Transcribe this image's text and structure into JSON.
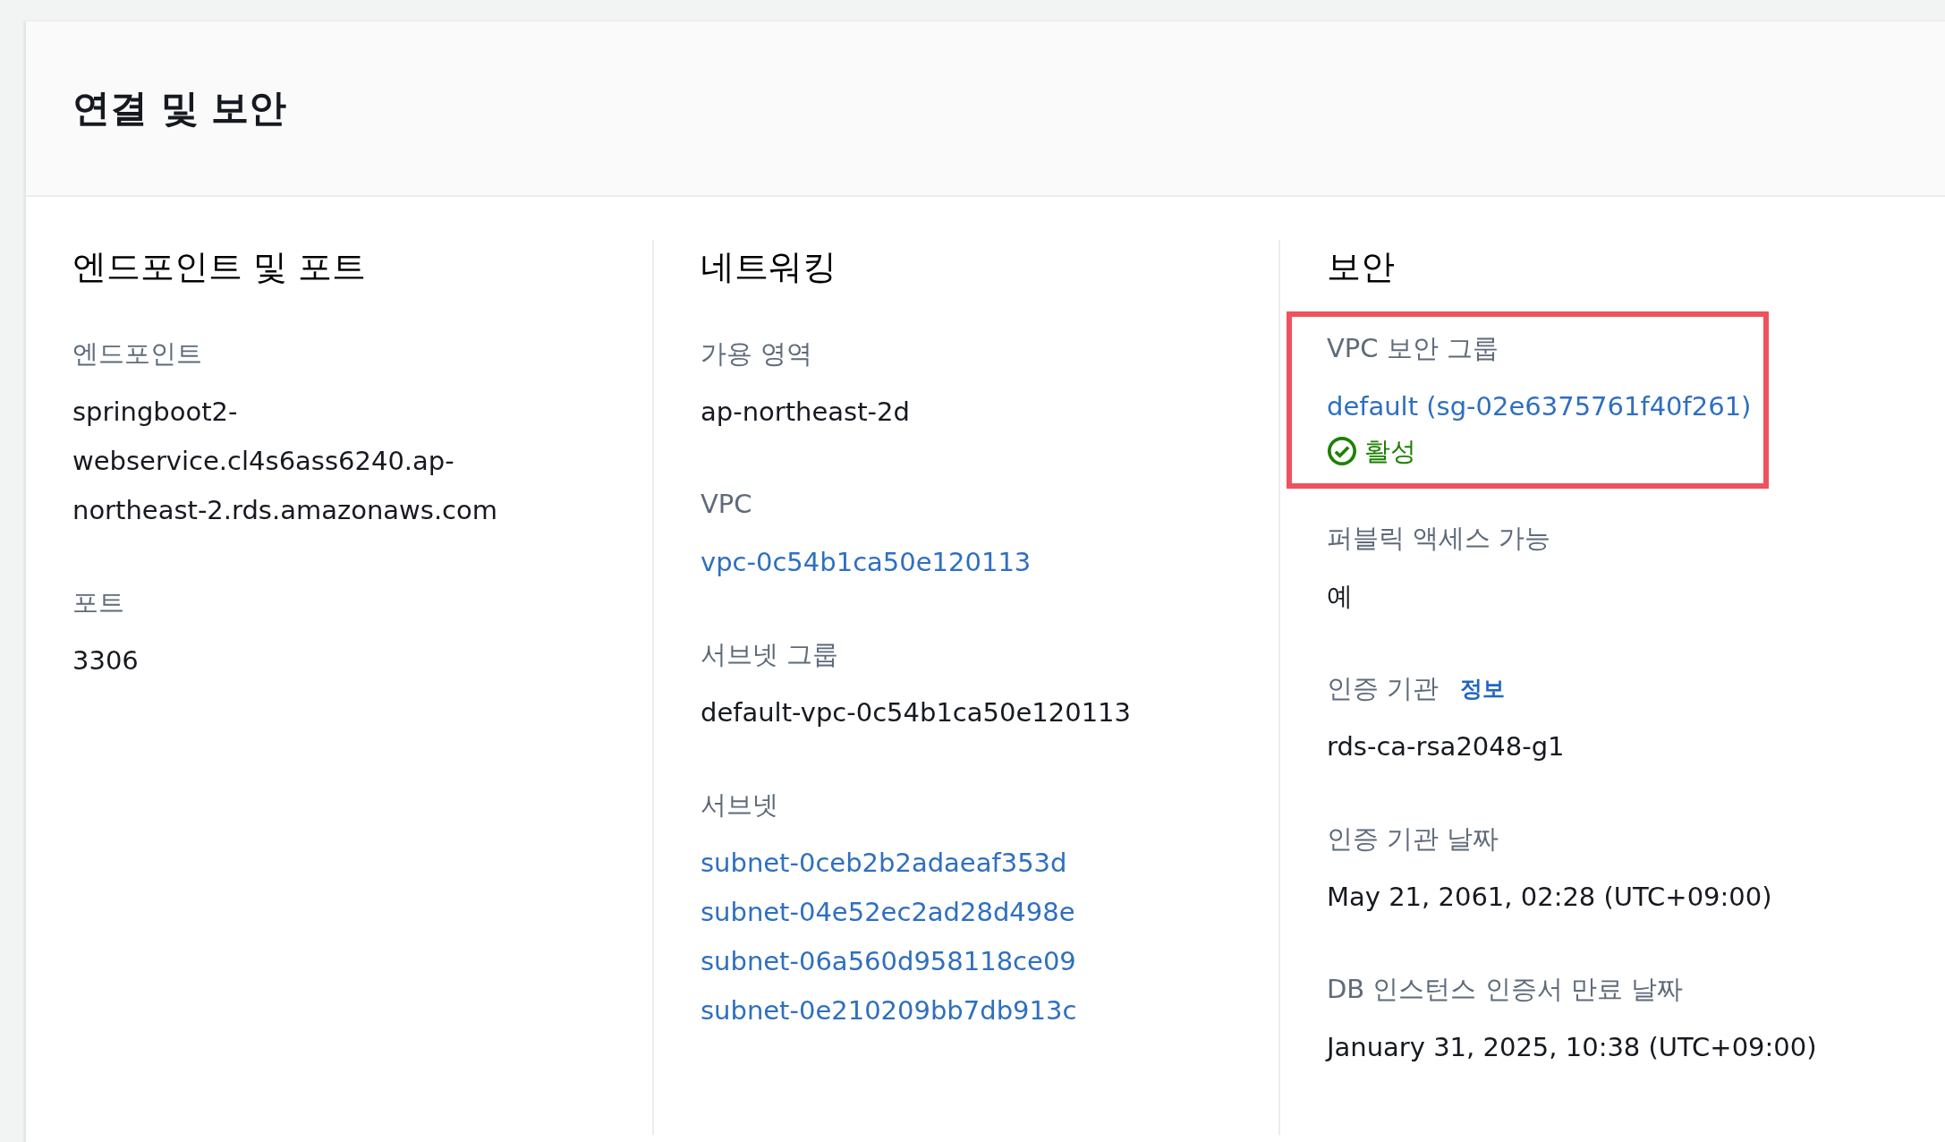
{
  "panel": {
    "title": "연결 및 보안"
  },
  "columns": [
    {
      "heading": "엔드포인트 및 포트",
      "fields": [
        {
          "label": "엔드포인트",
          "highlighted": false,
          "values": [
            {
              "kind": "text",
              "text": "springboot2-webservice.cl4s6ass6240.ap-northeast-2.rds.amazonaws.com"
            }
          ]
        },
        {
          "label": "포트",
          "highlighted": false,
          "values": [
            {
              "kind": "text",
              "text": "3306"
            }
          ]
        }
      ]
    },
    {
      "heading": "네트워킹",
      "fields": [
        {
          "label": "가용 영역",
          "highlighted": false,
          "values": [
            {
              "kind": "text",
              "text": "ap-northeast-2d"
            }
          ]
        },
        {
          "label": "VPC",
          "highlighted": false,
          "values": [
            {
              "kind": "link",
              "text": "vpc-0c54b1ca50e120113"
            }
          ]
        },
        {
          "label": "서브넷 그룹",
          "highlighted": false,
          "values": [
            {
              "kind": "text",
              "text": "default-vpc-0c54b1ca50e120113"
            }
          ]
        },
        {
          "label": "서브넷",
          "highlighted": false,
          "values": [
            {
              "kind": "link",
              "text": "subnet-0ceb2b2adaeaf353d"
            },
            {
              "kind": "link",
              "text": "subnet-04e52ec2ad28d498e"
            },
            {
              "kind": "link",
              "text": "subnet-06a560d958118ce09"
            },
            {
              "kind": "link",
              "text": "subnet-0e210209bb7db913c"
            }
          ]
        }
      ]
    },
    {
      "heading": "보안",
      "fields": [
        {
          "label": "VPC 보안 그룹",
          "highlighted": true,
          "values": [
            {
              "kind": "link",
              "text": "default (sg-02e6375761f40f261)"
            },
            {
              "kind": "status",
              "text": "활성"
            }
          ]
        },
        {
          "label": "퍼블릭 액세스 가능",
          "highlighted": false,
          "values": [
            {
              "kind": "text",
              "text": "예"
            }
          ]
        },
        {
          "label": "인증 기관",
          "info": "정보",
          "highlighted": false,
          "values": [
            {
              "kind": "text",
              "text": "rds-ca-rsa2048-g1"
            }
          ]
        },
        {
          "label": "인증 기관 날짜",
          "highlighted": false,
          "values": [
            {
              "kind": "text",
              "text": "May 21, 2061, 02:28 (UTC+09:00)"
            }
          ]
        },
        {
          "label": "DB 인스턴스 인증서 만료 날짜",
          "highlighted": false,
          "values": [
            {
              "kind": "text",
              "text": "January 31, 2025, 10:38 (UTC+09:00)"
            }
          ]
        }
      ]
    }
  ]
}
